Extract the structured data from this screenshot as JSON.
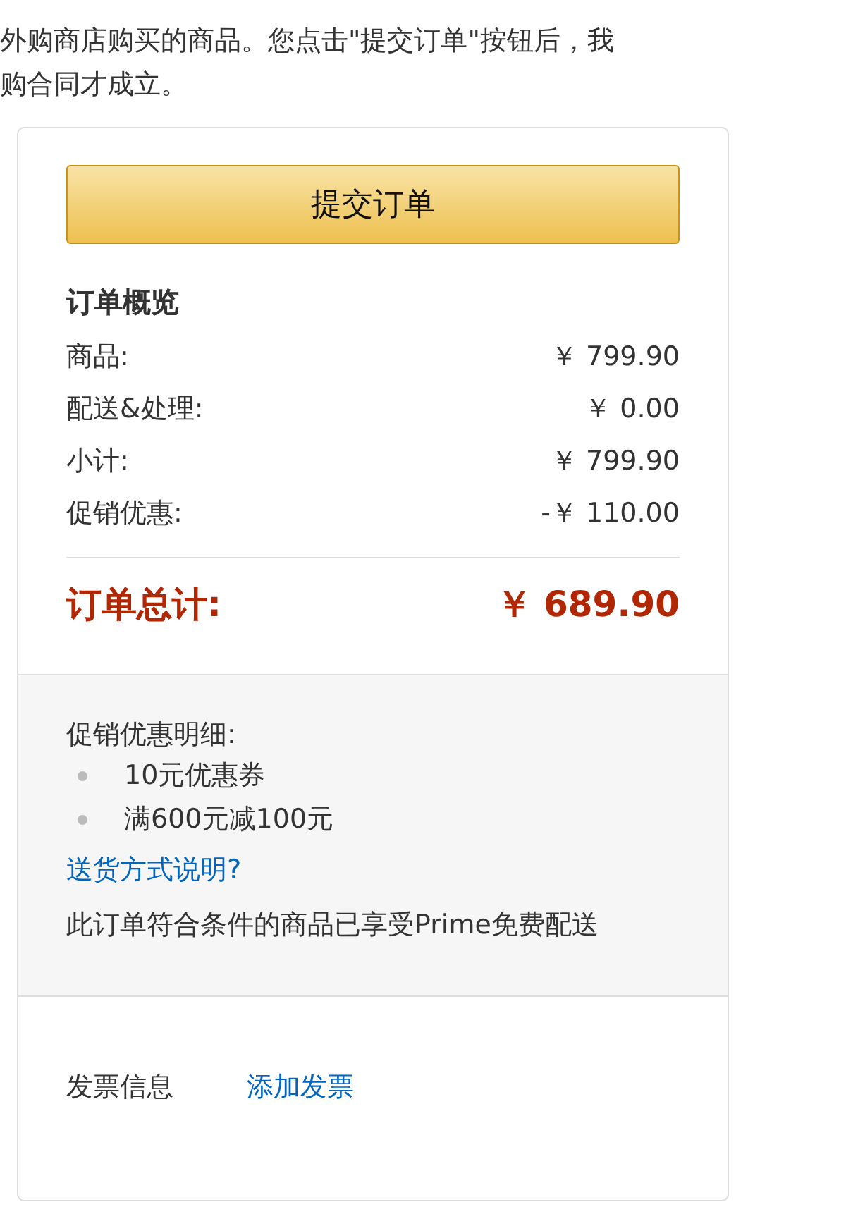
{
  "intro_lines": [
    "外购商店购买的商品。您点击\"提交订单\"按钮后，我",
    "购合同才成立。"
  ],
  "submit_button": "提交订单",
  "summary": {
    "title": "订单概览",
    "rows": [
      {
        "label": "商品:",
        "amount": "￥ 799.90"
      },
      {
        "label": "配送&处理:",
        "amount": "￥ 0.00"
      },
      {
        "label": "小计:",
        "amount": "￥ 799.90"
      },
      {
        "label": "促销优惠:",
        "amount": "-￥ 110.00"
      }
    ],
    "total": {
      "label": "订单总计:",
      "amount": "￥ 689.90"
    }
  },
  "promotions": {
    "title": "促销优惠明细:",
    "items": [
      "10元优惠券",
      "满600元减100元"
    ],
    "shipping_link": "送货方式说明?",
    "prime_note": "此订单符合条件的商品已享受Prime免费配送"
  },
  "invoice": {
    "label": "发票信息",
    "link": "添加发票"
  }
}
